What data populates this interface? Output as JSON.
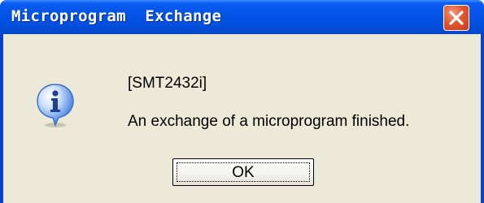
{
  "dialog": {
    "title": "Microprogram  Exchange",
    "close_icon": "close-icon",
    "icon": "information-icon",
    "device_label": "[SMT2432i]",
    "message": "An exchange of a microprogram finished.",
    "ok_label": "OK"
  },
  "colors": {
    "titlebar": "#0454e6",
    "close_button": "#e2582f",
    "client_background": "#ece9d8",
    "icon_blue": "#2a6ed8"
  }
}
